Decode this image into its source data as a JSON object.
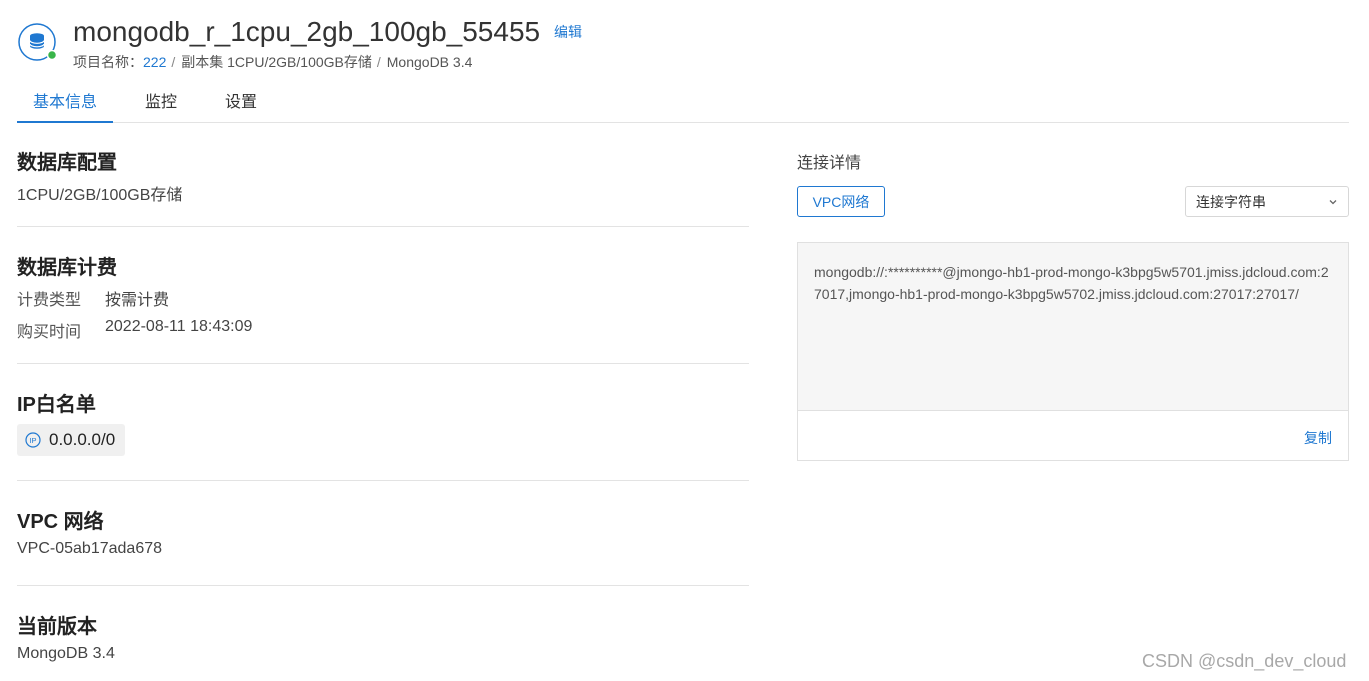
{
  "header": {
    "instance_name": "mongodb_r_1cpu_2gb_100gb_55455",
    "edit_label": "编辑",
    "project_label": "项目名称：",
    "project_value": "222",
    "separator": "/",
    "spec_text": "副本集 1CPU/2GB/100GB存储",
    "engine_text": "MongoDB 3.4",
    "status_color": "#39b54a"
  },
  "tabs": [
    {
      "label": "基本信息",
      "active": true
    },
    {
      "label": "监控",
      "active": false
    },
    {
      "label": "设置",
      "active": false
    }
  ],
  "db_config": {
    "title": "数据库配置",
    "value": "1CPU/2GB/100GB存储"
  },
  "billing": {
    "title": "数据库计费",
    "rows": [
      {
        "key": "计费类型",
        "value": "按需计费"
      },
      {
        "key": "购买时间",
        "value": "2022-08-11 18:43:09"
      }
    ]
  },
  "ip_whitelist": {
    "title": "IP白名单",
    "icon": "ip-icon",
    "value": "0.0.0.0/0"
  },
  "vpc": {
    "title": "VPC 网络",
    "value": "VPC-05ab17ada678"
  },
  "version": {
    "title": "当前版本",
    "value": "MongoDB 3.4"
  },
  "connection": {
    "title": "连接详情",
    "network_button": "VPC网络",
    "select_value": "连接字符串",
    "connection_string": "mongodb://:**********@jmongo-hb1-prod-mongo-k3bpg5w5701.jmiss.jdcloud.com:27017,jmongo-hb1-prod-mongo-k3bpg5w5702.jmiss.jdcloud.com:27017:27017/",
    "copy_label": "复制"
  },
  "watermark": "CSDN @csdn_dev_cloud",
  "colors": {
    "accent": "#1f78d1",
    "divider": "#e3e3e3"
  }
}
